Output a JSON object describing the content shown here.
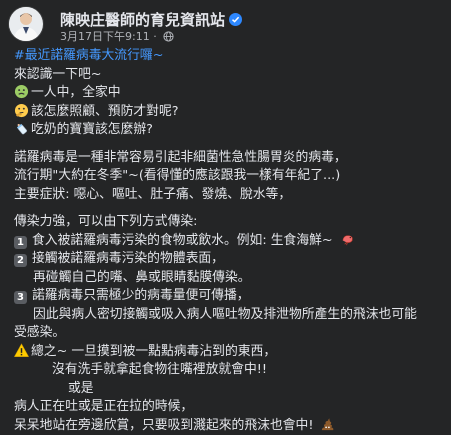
{
  "header": {
    "page_name": "陳映庄醫師的育兒資訊站",
    "timestamp": "3月17日下午9:11",
    "separator": " · "
  },
  "post": {
    "hashtag": "#最近諾羅病毒大流行囉~",
    "intro": "來認識一下吧~",
    "q1": "一人中，全家中",
    "q2": "該怎麼照顧、預防才對呢?",
    "q3": "吃奶的寶寶該怎麼辦?",
    "p1_l1": "諾羅病毒是一種非常容易引起非細菌性急性腸胃炎的病毒，",
    "p1_l2": "流行期\"大約在冬季\"~(看得懂的應該跟我一樣有年紀了...)",
    "p1_l3": "主要症狀: 噁心、嘔吐、肚子痛、發燒、脫水等，",
    "p2_title": "傳染力強，可以由下列方式傳染:",
    "item1_num": "1",
    "item1": "食入被諾羅病毒污染的食物或飲水。例如: 生食海鮮~",
    "item2_num": "2",
    "item2_l1": "接觸被諾羅病毒污染的物體表面，",
    "item2_l2": "再碰觸自己的嘴、鼻或眼睛黏膜傳染。",
    "item3_num": "3",
    "item3_l1": "諾羅病毒只需極少的病毒量便可傳播，",
    "item3_l2": "因此與病人密切接觸或吸入病人嘔吐物及排泄物所產生的飛沫也可能",
    "item3_l3": "受感染。",
    "warn_l1": "總之~ 一旦摸到被一點點病毒沾到的東西，",
    "warn_l2": "沒有洗手就拿起食物往嘴裡放就會中!!",
    "warn_l3": "或是",
    "warn_l4": "病人正在吐或是正在拉的時候，",
    "warn_l5": "呆呆地站在旁邊欣賞，只要吸到濺起來的飛沫也會中!"
  },
  "colors": {
    "background": "#242526",
    "text": "#e4e6eb",
    "secondary_text": "#b0b3b8",
    "hashtag": "#4599ff",
    "verified": "#2d88ff"
  },
  "icons": [
    "verified-badge-icon",
    "globe-icon",
    "sick-face-icon",
    "thinking-face-icon",
    "baby-bottle-icon",
    "shrimp-icon",
    "warning-icon",
    "poop-icon"
  ]
}
